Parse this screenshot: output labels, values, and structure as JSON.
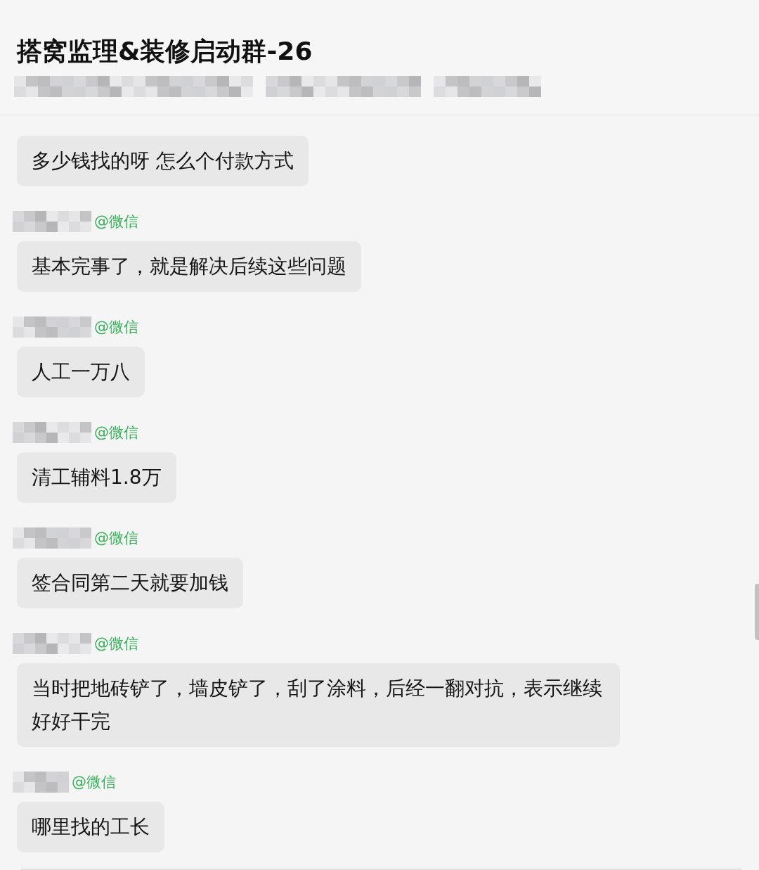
{
  "header": {
    "title": "搭窝监理&装修启动群-26"
  },
  "messages": [
    {
      "text": "多少钱找的呀 怎么个付款方式"
    },
    {
      "sender_tag": "@微信",
      "text": "基本完事了，就是解决后续这些问题"
    },
    {
      "sender_tag": "@微信",
      "text": "人工一万八"
    },
    {
      "sender_tag": "@微信",
      "text": "清工辅料1.8万"
    },
    {
      "sender_tag": "@微信",
      "text": "签合同第二天就要加钱"
    },
    {
      "sender_tag": "@微信",
      "text": "当时把地砖铲了，墙皮铲了，刮了涂料，后经一翻对抗，表示继续好好干完"
    },
    {
      "sender_tag": "@微信",
      "text": "哪里找的工长"
    }
  ]
}
